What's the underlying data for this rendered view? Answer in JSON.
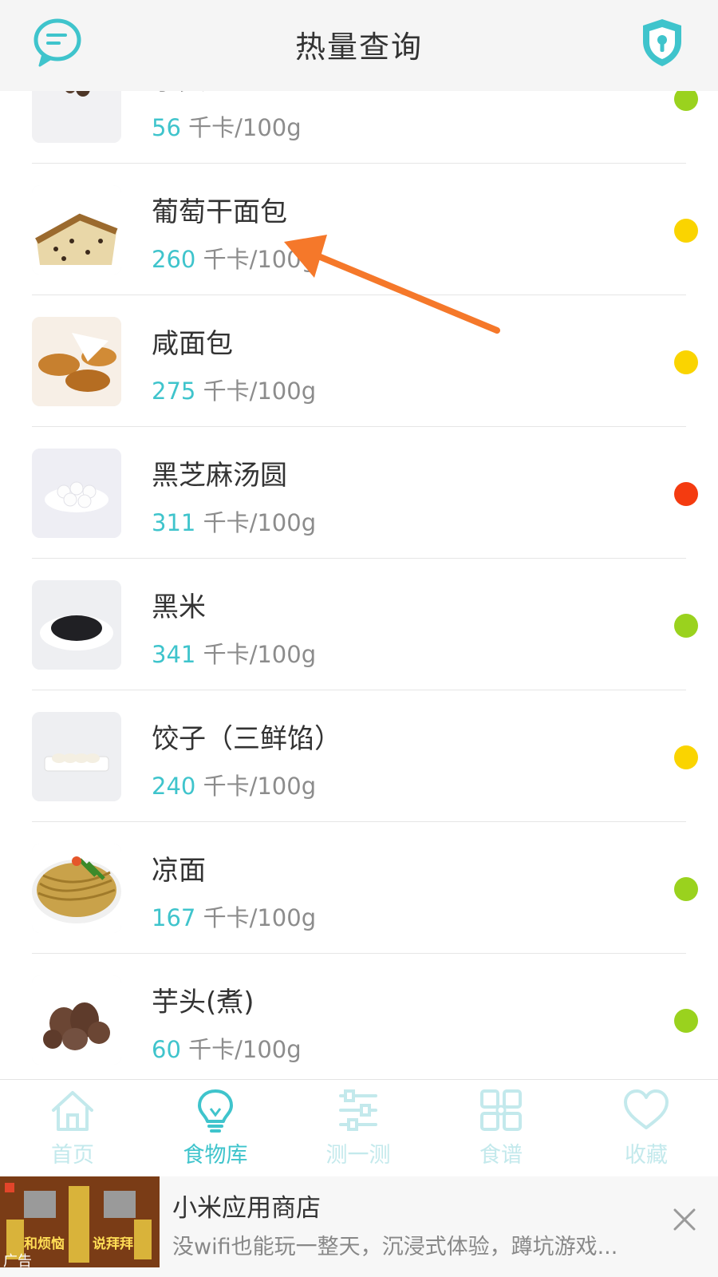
{
  "header": {
    "title": "热量查询",
    "left_icon": "chat-bubble-icon",
    "right_icon": "shield-lock-icon",
    "accent": "#3fc4cc"
  },
  "unit_text": "千卡/100g",
  "food_list": [
    {
      "name": "芋头",
      "calories": "56",
      "dot_color": "#9ad21e",
      "thumb_icon": "taro-small"
    },
    {
      "name": "葡萄干面包",
      "calories": "260",
      "dot_color": "#fad400",
      "thumb_icon": "raisin-bread"
    },
    {
      "name": "咸面包",
      "calories": "275",
      "dot_color": "#fad400",
      "thumb_icon": "croissant"
    },
    {
      "name": "黑芝麻汤圆",
      "calories": "311",
      "dot_color": "#f43b10",
      "thumb_icon": "tangyuan"
    },
    {
      "name": "黑米",
      "calories": "341",
      "dot_color": "#9ad21e",
      "thumb_icon": "black-rice"
    },
    {
      "name": "饺子（三鲜馅）",
      "calories": "240",
      "dot_color": "#fad400",
      "thumb_icon": "dumpling"
    },
    {
      "name": "凉面",
      "calories": "167",
      "dot_color": "#9ad21e",
      "thumb_icon": "cold-noodles"
    },
    {
      "name": "芋头(煮)",
      "calories": "60",
      "dot_color": "#9ad21e",
      "thumb_icon": "taro"
    }
  ],
  "bottom_nav": [
    {
      "label": "首页",
      "icon": "home-icon",
      "active": false
    },
    {
      "label": "食物库",
      "icon": "lightbulb-icon",
      "active": true
    },
    {
      "label": "测一测",
      "icon": "sliders-icon",
      "active": false
    },
    {
      "label": "食谱",
      "icon": "grid-icon",
      "active": false
    },
    {
      "label": "收藏",
      "icon": "heart-icon",
      "active": false
    }
  ],
  "ad": {
    "title": "小米应用商店",
    "description": "没wifi也能玩一整天，沉浸式体验，蹲坑游戏...",
    "tag": "广告",
    "thumb_text_left": "和烦恼",
    "thumb_text_right": "说拜拜"
  },
  "annotation": {
    "type": "arrow",
    "color": "#f5782a",
    "target": "葡萄干面包"
  }
}
